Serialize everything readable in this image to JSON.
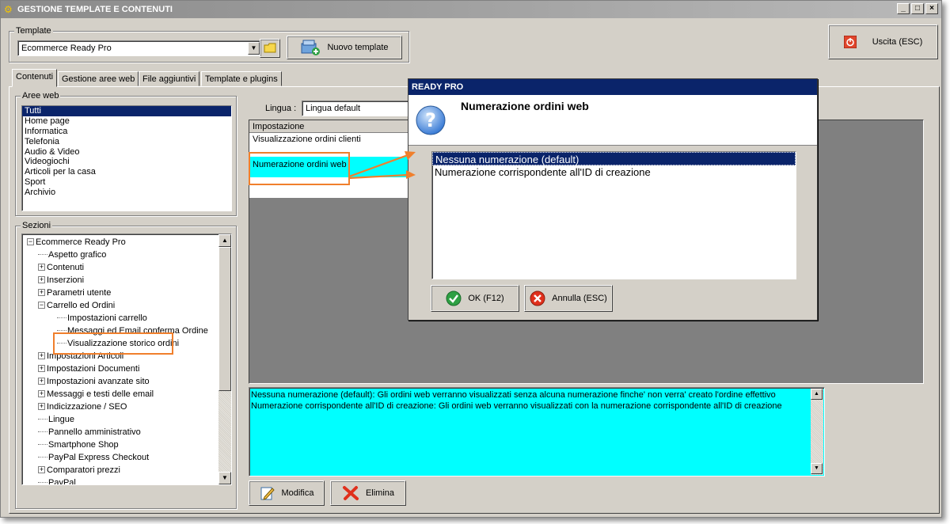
{
  "window": {
    "title": "GESTIONE TEMPLATE E CONTENUTI",
    "controls": [
      "_",
      "□",
      "×"
    ]
  },
  "template_group": {
    "label": "Template",
    "selected": "Ecommerce Ready Pro",
    "new_button": "Nuovo template"
  },
  "exit_button": "Uscita (ESC)",
  "tabs": [
    "Contenuti",
    "Gestione aree web",
    "File aggiuntivi",
    "Template e plugins"
  ],
  "aree_web": {
    "label": "Aree web",
    "items": [
      "Tutti",
      "Home page",
      "Informatica",
      "Telefonia",
      "Audio & Video",
      "Videogiochi",
      "Articoli per la casa",
      "Sport",
      "Archivio"
    ],
    "selected_index": 0
  },
  "sezioni": {
    "label": "Sezioni",
    "tree": [
      {
        "text": "Ecommerce Ready Pro",
        "level": 0,
        "exp": "−"
      },
      {
        "text": "Aspetto grafico",
        "level": 1,
        "exp": ""
      },
      {
        "text": "Contenuti",
        "level": 1,
        "exp": "+"
      },
      {
        "text": "Inserzioni",
        "level": 1,
        "exp": "+"
      },
      {
        "text": "Parametri utente",
        "level": 1,
        "exp": "+"
      },
      {
        "text": "Carrello ed Ordini",
        "level": 1,
        "exp": "−"
      },
      {
        "text": "Impostazioni carrello",
        "level": 2,
        "exp": ""
      },
      {
        "text": "Messaggi ed Email conferma Ordine",
        "level": 2,
        "exp": ""
      },
      {
        "text": "Visualizzazione storico ordini",
        "level": 2,
        "exp": ""
      },
      {
        "text": "Impostazioni Articoli",
        "level": 1,
        "exp": "+"
      },
      {
        "text": "Impostazioni Documenti",
        "level": 1,
        "exp": "+"
      },
      {
        "text": "Impostazioni avanzate sito",
        "level": 1,
        "exp": "+"
      },
      {
        "text": "Messaggi e testi delle email",
        "level": 1,
        "exp": "+"
      },
      {
        "text": "Indicizzazione / SEO",
        "level": 1,
        "exp": "+"
      },
      {
        "text": "Lingue",
        "level": 1,
        "exp": ""
      },
      {
        "text": "Pannello amministrativo",
        "level": 1,
        "exp": ""
      },
      {
        "text": "Smartphone Shop",
        "level": 1,
        "exp": ""
      },
      {
        "text": "PayPal Express Checkout",
        "level": 1,
        "exp": ""
      },
      {
        "text": "Comparatori prezzi",
        "level": 1,
        "exp": "+"
      },
      {
        "text": "PayPal",
        "level": 1,
        "exp": ""
      }
    ]
  },
  "lingua": {
    "label": "Lingua :",
    "value": "Lingua default"
  },
  "grid": {
    "header": "Impostazione",
    "rows": [
      "Visualizzazione ordini clienti",
      "Numerazione ordini web"
    ]
  },
  "description": {
    "lines": [
      "Nessuna numerazione (default): Gli ordini web verranno visualizzati senza alcuna numerazione finche' non verra' creato l'ordine effettivo",
      "Numerazione corrispondente all'ID di creazione: Gli ordini web verranno visualizzati con la numerazione corrispondente all'ID di creazione"
    ]
  },
  "bottom_buttons": {
    "modify": "Modifica",
    "delete": "Elimina"
  },
  "dialog": {
    "title": "READY PRO",
    "heading": "Numerazione ordini web",
    "options": [
      "Nessuna numerazione (default)",
      "Numerazione corrispondente all'ID di creazione"
    ],
    "selected_index": 0,
    "ok": "OK (F12)",
    "cancel": "Annulla (ESC)"
  },
  "colors": {
    "cyan": "#00ffff",
    "selection": "#0a246a",
    "highlight_box": "#f07f2c"
  }
}
